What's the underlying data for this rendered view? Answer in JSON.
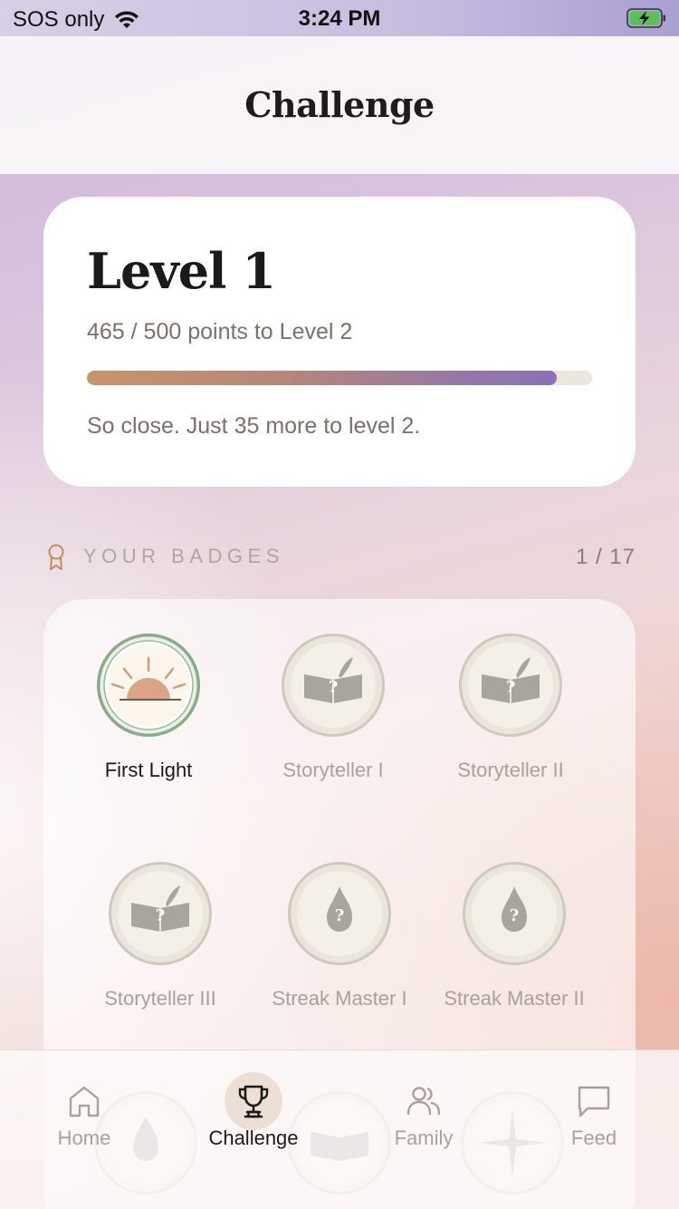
{
  "status_bar": {
    "carrier": "SOS only",
    "time": "3:24 PM"
  },
  "header": {
    "title": "Challenge"
  },
  "level": {
    "title": "Level 1",
    "points_text": "465 / 500 points to Level 2",
    "progress_fraction": 0.93,
    "message": "So close. Just 35 more to level 2."
  },
  "badges": {
    "section_label": "YOUR BADGES",
    "count": "1 / 17",
    "items": [
      {
        "label": "First Light",
        "earned": true,
        "icon": "sunrise-icon"
      },
      {
        "label": "Storyteller I",
        "earned": false,
        "icon": "book-quill-icon"
      },
      {
        "label": "Storyteller II",
        "earned": false,
        "icon": "book-quill-icon"
      },
      {
        "label": "Storyteller III",
        "earned": false,
        "icon": "book-quill-icon"
      },
      {
        "label": "Streak Master I",
        "earned": false,
        "icon": "flame-icon"
      },
      {
        "label": "Streak Master II",
        "earned": false,
        "icon": "flame-icon"
      }
    ]
  },
  "tabs": [
    {
      "label": "Home",
      "icon": "home-icon",
      "active": false
    },
    {
      "label": "Challenge",
      "icon": "trophy-icon",
      "active": true
    },
    {
      "label": "Family",
      "icon": "people-icon",
      "active": false
    },
    {
      "label": "Feed",
      "icon": "chat-bubble-icon",
      "active": false
    }
  ],
  "colors": {
    "accent_gradient_start": "#c8946a",
    "accent_gradient_end": "#8a71b6",
    "earned_ring": "#8aab8a",
    "locked_medal": "#e7e2d8"
  }
}
